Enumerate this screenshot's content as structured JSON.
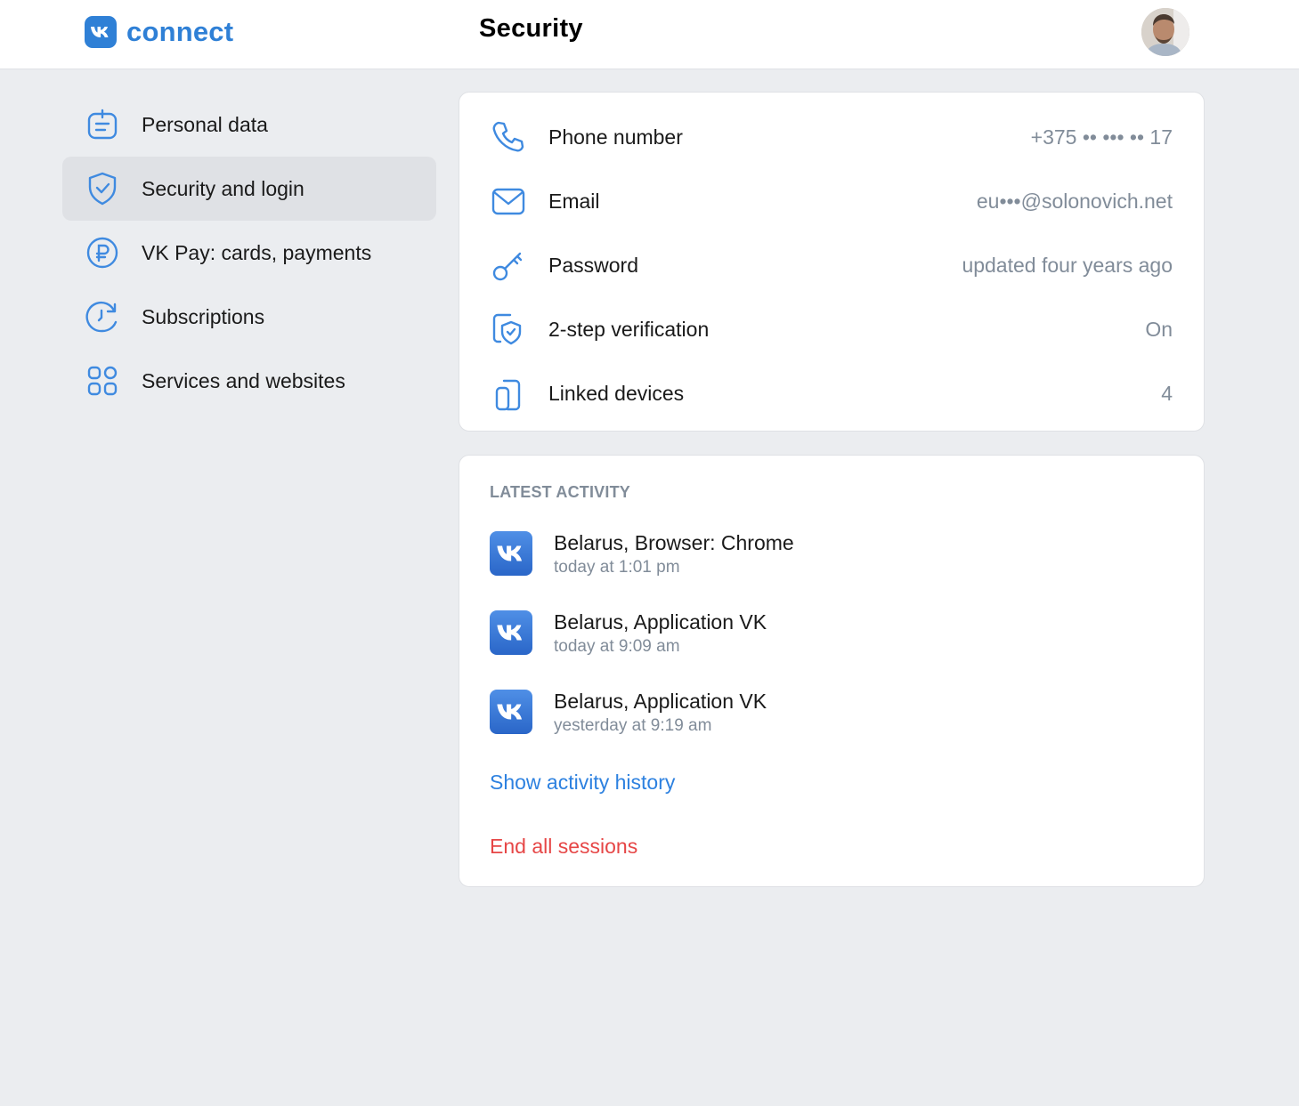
{
  "header": {
    "logo_text": "connect",
    "title": "Security",
    "logo_icon": "vk-logo-icon",
    "avatar": "user-avatar"
  },
  "sidebar": {
    "items": [
      {
        "label": "Personal data",
        "icon": "id-card-icon",
        "active": false
      },
      {
        "label": "Security and login",
        "icon": "shield-check-icon",
        "active": true
      },
      {
        "label": "VK Pay: cards, payments",
        "icon": "ruble-icon",
        "active": false
      },
      {
        "label": "Subscriptions",
        "icon": "renew-clock-icon",
        "active": false
      },
      {
        "label": "Services and websites",
        "icon": "apps-grid-icon",
        "active": false
      }
    ]
  },
  "security": {
    "rows": [
      {
        "label": "Phone number",
        "value": "+375 •• ••• •• 17",
        "icon": "phone-icon"
      },
      {
        "label": "Email",
        "value": "eu•••@solonovich.net",
        "icon": "mail-icon"
      },
      {
        "label": "Password",
        "value": "updated four years ago",
        "icon": "key-icon"
      },
      {
        "label": "2-step verification",
        "value": "On",
        "icon": "shield-pages-icon"
      },
      {
        "label": "Linked devices",
        "value": "4",
        "icon": "devices-icon"
      }
    ]
  },
  "activity": {
    "title": "LATEST ACTIVITY",
    "items": [
      {
        "title": "Belarus, Browser: Chrome",
        "time": "today at 1:01 pm"
      },
      {
        "title": "Belarus, Application VK",
        "time": "today at 9:09 am"
      },
      {
        "title": "Belarus, Application VK",
        "time": "yesterday at 9:19 am"
      }
    ],
    "show_history": "Show activity history",
    "end_sessions": "End all sessions"
  },
  "colors": {
    "accent": "#2f80d6",
    "link": "#2d81e0",
    "danger": "#e64646",
    "secondary_text": "#818c99",
    "background": "#ebedf0"
  }
}
